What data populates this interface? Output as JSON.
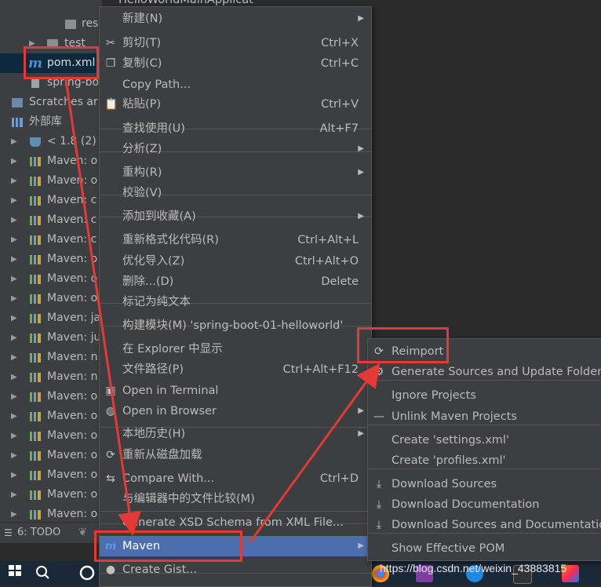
{
  "tree": {
    "items": [
      {
        "label": "res",
        "icon": "folder-icon"
      },
      {
        "label": "test",
        "icon": "folder-icon"
      },
      {
        "label": "pom.xml",
        "icon": "maven-file-icon"
      },
      {
        "label": "spring-bo",
        "icon": "file-icon"
      },
      {
        "label": "Scratches ar",
        "icon": "scratches-icon"
      },
      {
        "label": "外部库",
        "icon": "library-icon"
      },
      {
        "label": "< 1.8 (2)",
        "icon": "jdk-icon"
      },
      {
        "label": "Maven: o",
        "icon": "library-icon"
      },
      {
        "label": "Maven: o",
        "icon": "library-icon"
      },
      {
        "label": "Maven: c",
        "icon": "library-icon"
      },
      {
        "label": "Maven: c",
        "icon": "library-icon"
      },
      {
        "label": "Maven: c",
        "icon": "library-icon"
      },
      {
        "label": "Maven: o",
        "icon": "library-icon"
      },
      {
        "label": "Maven: o",
        "icon": "library-icon"
      },
      {
        "label": "Maven: o",
        "icon": "library-icon"
      },
      {
        "label": "Maven: ja",
        "icon": "library-icon"
      },
      {
        "label": "Maven: ju",
        "icon": "library-icon"
      },
      {
        "label": "Maven: n",
        "icon": "library-icon"
      },
      {
        "label": "Maven: n",
        "icon": "library-icon"
      },
      {
        "label": "Maven: o",
        "icon": "library-icon"
      },
      {
        "label": "Maven: o",
        "icon": "library-icon"
      },
      {
        "label": "Maven: o",
        "icon": "library-icon"
      },
      {
        "label": "Maven: o",
        "icon": "library-icon"
      },
      {
        "label": "Maven: o",
        "icon": "library-icon"
      },
      {
        "label": "Maven: o",
        "icon": "library-icon"
      },
      {
        "label": "Maven: o",
        "icon": "library-icon"
      }
    ]
  },
  "bottom": {
    "todo": "6: TODO"
  },
  "context_menu": {
    "top_partial": "HelloWorldMainApplicat",
    "items": [
      {
        "label": "新建(N)",
        "shortcut": "",
        "submenu": true,
        "icon": ""
      },
      {
        "label": "剪切(T)",
        "shortcut": "Ctrl+X",
        "icon": "cut-icon"
      },
      {
        "label": "复制(C)",
        "shortcut": "Ctrl+C",
        "icon": "copy-icon"
      },
      {
        "label": "Copy Path...",
        "shortcut": "",
        "icon": ""
      },
      {
        "label": "粘贴(P)",
        "shortcut": "Ctrl+V",
        "icon": "paste-icon"
      },
      {
        "label": "查找使用(U)",
        "shortcut": "Alt+F7",
        "icon": ""
      },
      {
        "label": "分析(Z)",
        "shortcut": "",
        "submenu": true,
        "icon": ""
      },
      {
        "label": "重构(R)",
        "shortcut": "",
        "submenu": true,
        "icon": ""
      },
      {
        "label": "校验(V)",
        "shortcut": "",
        "icon": ""
      },
      {
        "label": "添加到收藏(A)",
        "shortcut": "",
        "submenu": true,
        "icon": ""
      },
      {
        "label": "重新格式化代码(R)",
        "shortcut": "Ctrl+Alt+L",
        "icon": ""
      },
      {
        "label": "优化导入(Z)",
        "shortcut": "Ctrl+Alt+O",
        "icon": ""
      },
      {
        "label": "删除...(D)",
        "shortcut": "Delete",
        "icon": ""
      },
      {
        "label": "标记为纯文本",
        "shortcut": "",
        "icon": ""
      },
      {
        "label": "构建模块(M) 'spring-boot-01-helloworld'",
        "shortcut": "",
        "icon": ""
      },
      {
        "label": "在 Explorer 中显示",
        "shortcut": "",
        "icon": ""
      },
      {
        "label": "文件路径(P)",
        "shortcut": "Ctrl+Alt+F12",
        "icon": ""
      },
      {
        "label": "Open in Terminal",
        "shortcut": "",
        "icon": "terminal-icon"
      },
      {
        "label": "Open in Browser",
        "shortcut": "",
        "submenu": true,
        "icon": "globe-icon"
      },
      {
        "label": "本地历史(H)",
        "shortcut": "",
        "submenu": true,
        "icon": ""
      },
      {
        "label": "重新从磁盘加载",
        "shortcut": "",
        "icon": "reload-icon"
      },
      {
        "label": "Compare With...",
        "shortcut": "Ctrl+D",
        "icon": "compare-icon"
      },
      {
        "label": "与编辑器中的文件比较(M)",
        "shortcut": "",
        "icon": ""
      },
      {
        "label": "Generate XSD Schema from XML File...",
        "shortcut": "",
        "icon": ""
      },
      {
        "label": "Maven",
        "shortcut": "",
        "submenu": true,
        "icon": "maven-icon"
      },
      {
        "label": "Create Gist...",
        "shortcut": "",
        "icon": "github-icon"
      }
    ]
  },
  "maven_menu": {
    "items": [
      {
        "label": "Reimport",
        "icon": "refresh-icon"
      },
      {
        "label": "Generate Sources and Update Folders",
        "icon": "generate-icon"
      },
      {
        "label": "Ignore Projects",
        "icon": ""
      },
      {
        "label": "Unlink Maven Projects",
        "icon": "minus-icon"
      },
      {
        "label": "Create 'settings.xml'",
        "icon": ""
      },
      {
        "label": "Create 'profiles.xml'",
        "icon": ""
      },
      {
        "label": "Download Sources",
        "icon": "download-icon"
      },
      {
        "label": "Download Documentation",
        "icon": "download-icon"
      },
      {
        "label": "Download Sources and Documentation",
        "icon": "download-icon"
      },
      {
        "label": "Show Effective POM",
        "icon": ""
      }
    ]
  },
  "watermark": "https://blog.csdn.net/weixin_43883815",
  "colors": {
    "highlight": "#4b6eaf",
    "annotation": "#e53935",
    "menu_bg": "#3c3f41"
  }
}
